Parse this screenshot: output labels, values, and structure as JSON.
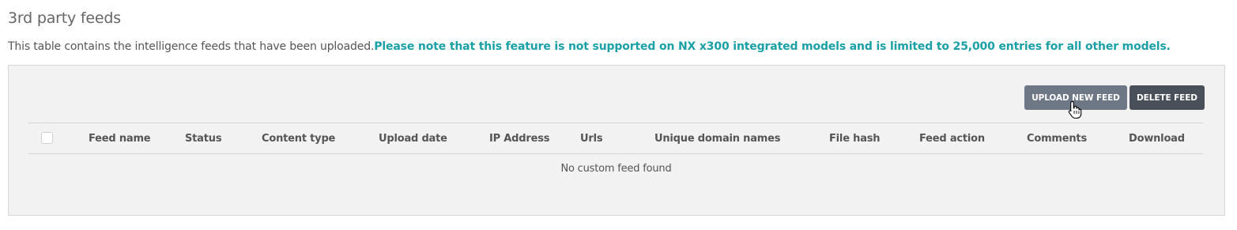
{
  "page": {
    "title": "3rd party feeds",
    "description": "This table contains the intelligence feeds that have been uploaded.",
    "note": "Please note that this feature is not supported on NX x300 integrated models and is limited to 25,000 entries for all other models."
  },
  "toolbar": {
    "upload_label": "UPLOAD NEW FEED",
    "delete_label": "DELETE FEED"
  },
  "table": {
    "columns": [
      "Feed name",
      "Status",
      "Content type",
      "Upload date",
      "IP Address",
      "Urls",
      "Unique domain names",
      "File hash",
      "Feed action",
      "Comments",
      "Download"
    ],
    "select_all_checked": false,
    "empty_message": "No custom feed found"
  },
  "colors": {
    "note": "#1aa0a6",
    "upload_button": "#6d7785",
    "delete_button": "#4a5059",
    "panel_background": "#f2f2f2"
  },
  "icons": {
    "cursor": "hand-pointer-icon"
  }
}
